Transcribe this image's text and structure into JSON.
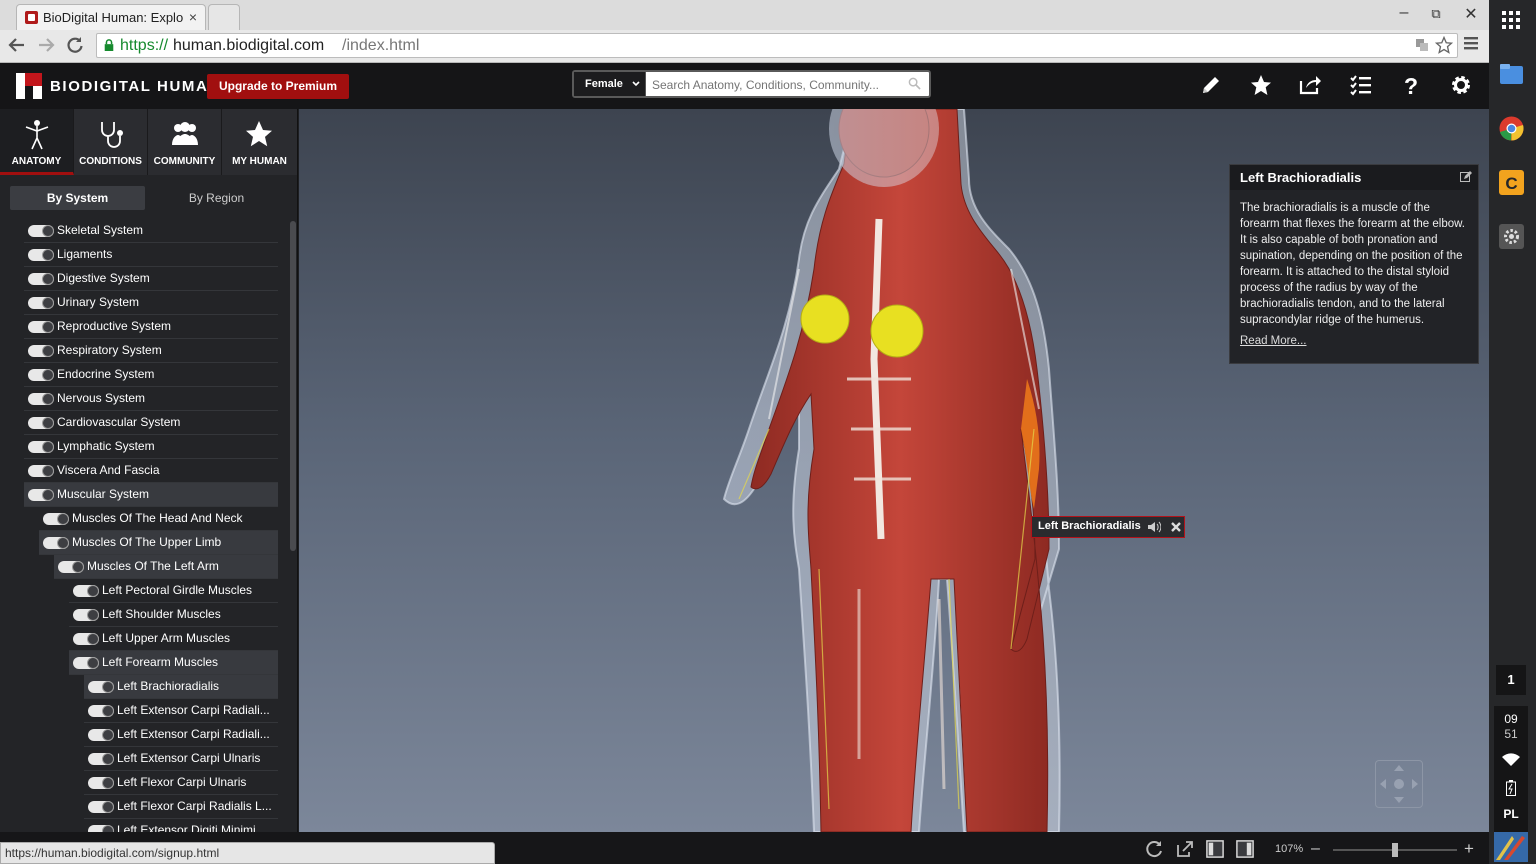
{
  "browser": {
    "tab_title": "BioDigital Human: Explo",
    "tab_close": "×",
    "win_minimize": "–",
    "win_restore": "⧉",
    "win_close": "✕",
    "url_scheme": "https://",
    "url_host": "human.biodigital.com",
    "url_path": "/index.html",
    "status_url": "https://human.biodigital.com/signup.html"
  },
  "header": {
    "logo_text": "BIODIGITAL HUMAN",
    "upgrade_label": "Upgrade to Premium",
    "gender": "Female",
    "search_placeholder": "Search Anatomy, Conditions, Community..."
  },
  "nav_tabs": [
    {
      "label": "ANATOMY",
      "icon": "person-icon"
    },
    {
      "label": "CONDITIONS",
      "icon": "stethoscope-icon"
    },
    {
      "label": "COMMUNITY",
      "icon": "people-icon"
    },
    {
      "label": "MY HUMAN",
      "icon": "star-icon"
    }
  ],
  "segments": {
    "by_system": "By System",
    "by_region": "By Region"
  },
  "tree": [
    {
      "label": "Skeletal System",
      "level": 0,
      "expand": "right"
    },
    {
      "label": "Ligaments",
      "level": 0,
      "expand": "right"
    },
    {
      "label": "Digestive System",
      "level": 0,
      "expand": "right"
    },
    {
      "label": "Urinary System",
      "level": 0,
      "expand": "right"
    },
    {
      "label": "Reproductive System",
      "level": 0,
      "expand": "right"
    },
    {
      "label": "Respiratory System",
      "level": 0,
      "expand": "right"
    },
    {
      "label": "Endocrine System",
      "level": 0,
      "expand": "right"
    },
    {
      "label": "Nervous System",
      "level": 0,
      "expand": "right"
    },
    {
      "label": "Cardiovascular System",
      "level": 0,
      "expand": "right"
    },
    {
      "label": "Lymphatic System",
      "level": 0,
      "expand": "right"
    },
    {
      "label": "Viscera And Fascia",
      "level": 0,
      "expand": "right"
    },
    {
      "label": "Muscular System",
      "level": 0,
      "expand": "down",
      "sel": true
    },
    {
      "label": "Muscles Of The Head And Neck",
      "level": 1,
      "expand": "right"
    },
    {
      "label": "Muscles Of The Upper Limb",
      "level": 1,
      "expand": "down",
      "sel": true
    },
    {
      "label": "Muscles Of The Left Arm",
      "level": 2,
      "expand": "down",
      "sel": true
    },
    {
      "label": "Left Pectoral Girdle Muscles",
      "level": 3,
      "expand": "right"
    },
    {
      "label": "Left Shoulder Muscles",
      "level": 3,
      "expand": "right"
    },
    {
      "label": "Left Upper Arm Muscles",
      "level": 3,
      "expand": "right"
    },
    {
      "label": "Left Forearm Muscles",
      "level": 3,
      "expand": "down",
      "sel": true
    },
    {
      "label": "Left Brachioradialis",
      "level": 4,
      "expand": "none",
      "sel": true
    },
    {
      "label": "Left Extensor Carpi Radiali...",
      "level": 4,
      "expand": "none"
    },
    {
      "label": "Left Extensor Carpi Radiali...",
      "level": 4,
      "expand": "none"
    },
    {
      "label": "Left Extensor Carpi Ulnaris",
      "level": 4,
      "expand": "none"
    },
    {
      "label": "Left Flexor Carpi Ulnaris",
      "level": 4,
      "expand": "none"
    },
    {
      "label": "Left Flexor Carpi Radialis L...",
      "level": 4,
      "expand": "none"
    },
    {
      "label": "Left Extensor Digiti Minimi",
      "level": 4,
      "expand": "none"
    }
  ],
  "info": {
    "title": "Left Brachioradialis",
    "body": "The brachioradialis is a muscle of the forearm that flexes the forearm at the elbow. It is also capable of both pronation and supination, depending on the position of the forearm. It is attached to the distal styloid process of the radius by way of the brachioradialis tendon, and to the lateral supracondylar ridge of the humerus.",
    "read_more": "Read More..."
  },
  "label_tag": "Left Brachioradialis",
  "zoom": {
    "label": "107%",
    "minus": "–",
    "plus": "+",
    "level": 0.5
  },
  "tray": {
    "badge": "1",
    "hour": "09",
    "minute": "51",
    "lang": "PL"
  },
  "colors": {
    "accent": "#a10f0f",
    "selected_row": "#383a3f",
    "muscle": "#b8382c"
  }
}
